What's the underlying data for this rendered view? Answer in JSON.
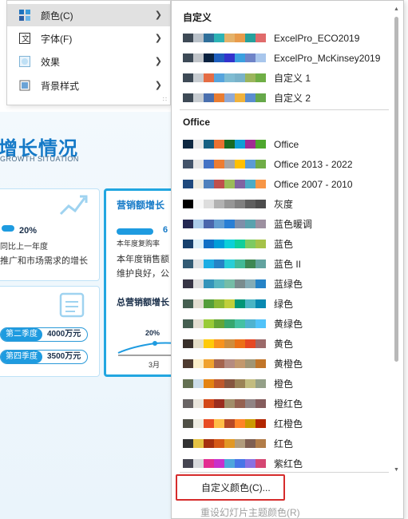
{
  "slide": {
    "title": "增长情况",
    "subtitle": "GROWTH SITUATION",
    "card1_pct": "20%",
    "card1_line1": "同比上一年度",
    "card1_line2": "推广和市场需求的增长",
    "card2_title": "营销额增长",
    "card2_value": "6",
    "card2_line1": "本年度复购率",
    "card2_line2": "本年度销售额",
    "card2_line3": "维护良好，公",
    "card2_line4": "总营销额增长",
    "card2_pct": "20%",
    "card2_month": "3月",
    "pill1_tag": "第二季度",
    "pill1_value": "4000万元",
    "pill2_tag": "第四季度",
    "pill2_value": "3500万元"
  },
  "context_menu": {
    "items": [
      {
        "label": "颜色(C)",
        "icon": "palette-icon",
        "has_submenu": true,
        "active": true
      },
      {
        "label": "字体(F)",
        "icon": "font-icon",
        "has_submenu": true,
        "active": false
      },
      {
        "label": "效果",
        "icon": "effect-icon",
        "has_submenu": true,
        "active": false
      },
      {
        "label": "背景样式",
        "icon": "background-icon",
        "has_submenu": true,
        "active": false
      }
    ]
  },
  "submenu": {
    "custom_header": "自定义",
    "custom_themes": [
      {
        "name": "ExcelPro_ECO2019",
        "colors": [
          "#3e4a56",
          "#b9c1c9",
          "#2f6f9a",
          "#2db3b5",
          "#e4b26a",
          "#e89b4b",
          "#26a19d",
          "#e06b6b"
        ]
      },
      {
        "name": "ExcelPro_McKinsey2019",
        "colors": [
          "#3d4a57",
          "#c0c4c9",
          "#0a2240",
          "#1f5fbf",
          "#3333cc",
          "#3aa0e0",
          "#6f84c8",
          "#a8c6ec"
        ]
      },
      {
        "name": "自定义 1",
        "colors": [
          "#3e4a56",
          "#c7ccd1",
          "#e46c44",
          "#56a4dd",
          "#7fbcd2",
          "#79b2c9",
          "#9bb55d",
          "#6fae46"
        ]
      },
      {
        "name": "自定义 2",
        "colors": [
          "#3e4a56",
          "#c7ccd1",
          "#4a6fae",
          "#e97d32",
          "#8ea9d6",
          "#f0b23c",
          "#5a8dd0",
          "#66a84a"
        ]
      }
    ],
    "office_header": "Office",
    "office_themes": [
      {
        "name": "Office",
        "colors": [
          "#0e2841",
          "#e8e8e8",
          "#156082",
          "#e97132",
          "#196b24",
          "#0f9ed5",
          "#a02b93",
          "#4ea72e"
        ]
      },
      {
        "name": "Office 2013 - 2022",
        "colors": [
          "#44546a",
          "#e7e6e6",
          "#4472c4",
          "#ed7d31",
          "#a5a5a5",
          "#ffc000",
          "#5b9bd5",
          "#70ad47"
        ]
      },
      {
        "name": "Office 2007 - 2010",
        "colors": [
          "#1f497d",
          "#eeece1",
          "#4f81bd",
          "#c0504d",
          "#9bbb59",
          "#8064a2",
          "#4bacc6",
          "#f79646"
        ]
      },
      {
        "name": "灰度",
        "colors": [
          "#000000",
          "#f8f8f8",
          "#dddddd",
          "#b2b2b2",
          "#969696",
          "#808080",
          "#5f5f5f",
          "#4d4d4d"
        ]
      },
      {
        "name": "蓝色暖调",
        "colors": [
          "#242852",
          "#acccea",
          "#4a66ac",
          "#629dd1",
          "#297fd5",
          "#7f8fa9",
          "#5aa2ae",
          "#9d90a0"
        ]
      },
      {
        "name": "蓝色",
        "colors": [
          "#17406d",
          "#dbeff9",
          "#0f6fc6",
          "#009dd9",
          "#0bd0d9",
          "#10cf9b",
          "#7cca62",
          "#a5c249"
        ]
      },
      {
        "name": "蓝色 II",
        "colors": [
          "#335b74",
          "#dfe3e5",
          "#1cade4",
          "#2683c6",
          "#27ced7",
          "#42ba97",
          "#3e8853",
          "#62a39f"
        ]
      },
      {
        "name": "蓝绿色",
        "colors": [
          "#373545",
          "#dedede",
          "#3494ba",
          "#58b6c0",
          "#75bda7",
          "#7a8c8e",
          "#84acb6",
          "#2683c6"
        ]
      },
      {
        "name": "绿色",
        "colors": [
          "#455f51",
          "#e3ded1",
          "#549e39",
          "#8ab833",
          "#c0cf3a",
          "#029676",
          "#4ab5c4",
          "#0989b1"
        ]
      },
      {
        "name": "黄绿色",
        "colors": [
          "#455f51",
          "#e3ded1",
          "#99cb38",
          "#63a537",
          "#37a76f",
          "#44c1a3",
          "#4eb3cf",
          "#51c3f9"
        ]
      },
      {
        "name": "黄色",
        "colors": [
          "#39302a",
          "#e5dec7",
          "#ffca08",
          "#f8931d",
          "#ce8d3e",
          "#ec7016",
          "#e64823",
          "#9c6a6a"
        ]
      },
      {
        "name": "黄橙色",
        "colors": [
          "#4e3b30",
          "#fbeec9",
          "#f0a22e",
          "#a5644e",
          "#b58b80",
          "#c3986d",
          "#a19574",
          "#c17529"
        ]
      },
      {
        "name": "橙色",
        "colors": [
          "#637052",
          "#ccddea",
          "#e48312",
          "#bd582c",
          "#865640",
          "#9b8357",
          "#c2bc80",
          "#94a088"
        ]
      },
      {
        "name": "橙红色",
        "colors": [
          "#696464",
          "#e9e5dc",
          "#d34817",
          "#9b2d1f",
          "#a28e6a",
          "#956251",
          "#918485",
          "#855d5d"
        ]
      },
      {
        "name": "红橙色",
        "colors": [
          "#505046",
          "#eeece1",
          "#e84c22",
          "#ffbd47",
          "#b64926",
          "#ff8427",
          "#cc9900",
          "#b22600"
        ]
      },
      {
        "name": "红色",
        "colors": [
          "#323232",
          "#e5c243",
          "#a5300f",
          "#d55816",
          "#e19825",
          "#b19c7d",
          "#7f5f52",
          "#b27d49"
        ]
      },
      {
        "name": "紫红色",
        "colors": [
          "#454551",
          "#d8d9dc",
          "#e32d91",
          "#c830cc",
          "#4ea6dc",
          "#4775e7",
          "#8971e1",
          "#d54773"
        ]
      }
    ],
    "custom_colors_label": "自定义颜色(C)...",
    "reset_label": "重设幻灯片主题颜色(R)"
  }
}
